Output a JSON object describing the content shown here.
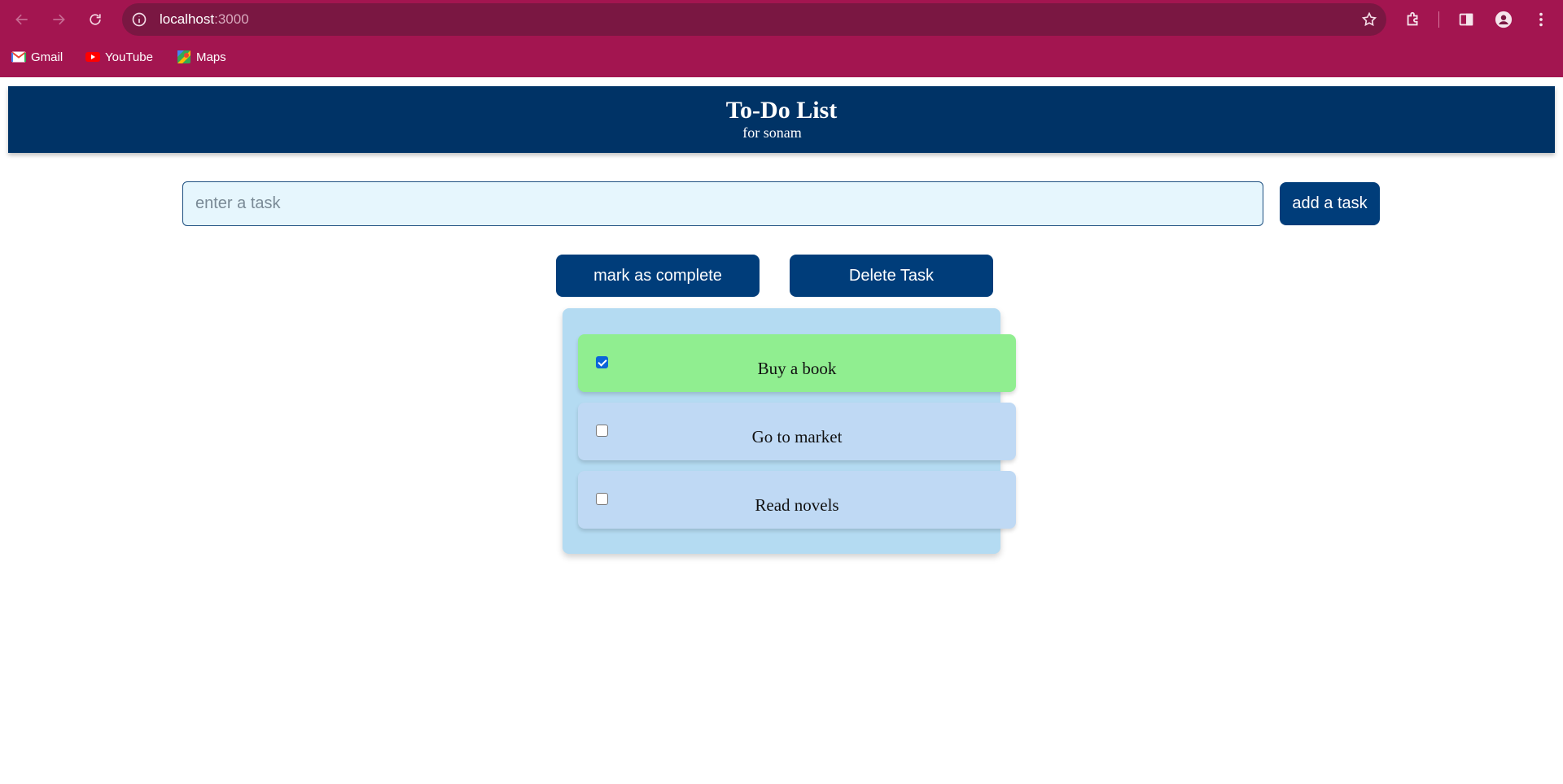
{
  "browser": {
    "url_host": "localhost",
    "url_port": ":3000",
    "bookmarks": [
      {
        "label": "Gmail",
        "icon": "gmail-icon"
      },
      {
        "label": "YouTube",
        "icon": "youtube-icon"
      },
      {
        "label": "Maps",
        "icon": "maps-icon"
      }
    ]
  },
  "app": {
    "title": "To-Do List",
    "subtitle": "for sonam"
  },
  "input": {
    "placeholder": "enter a task",
    "value": ""
  },
  "buttons": {
    "add": "add a task",
    "complete": "mark as complete",
    "delete": "Delete Task"
  },
  "tasks": [
    {
      "label": "Buy a book",
      "checked": true
    },
    {
      "label": "Go to market",
      "checked": false
    },
    {
      "label": "Read novels",
      "checked": false
    }
  ],
  "colors": {
    "chrome": "#a31550",
    "header": "#003366",
    "button": "#003d7a",
    "task_done": "#90ee90",
    "task_todo": "#bfd9f4",
    "panel": "#b4dbf2"
  }
}
